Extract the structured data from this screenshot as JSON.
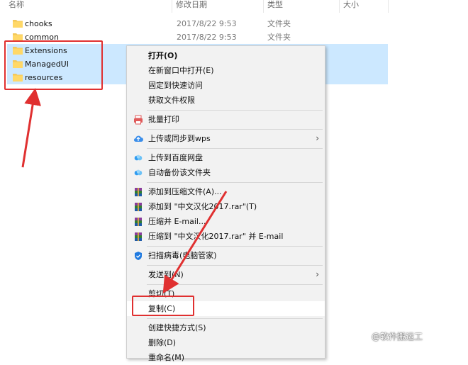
{
  "columns": {
    "name": "名称",
    "date": "修改日期",
    "type": "类型",
    "size": "大小"
  },
  "files": [
    {
      "name": "chooks",
      "date": "2017/8/22 9:53",
      "type": "文件夹",
      "selected": false
    },
    {
      "name": "common",
      "date": "2017/8/22 9:53",
      "type": "文件夹",
      "selected": false
    },
    {
      "name": "Extensions",
      "date": "",
      "type": "",
      "selected": true
    },
    {
      "name": "ManagedUI",
      "date": "",
      "type": "",
      "selected": true
    },
    {
      "name": "resources",
      "date": "",
      "type": "",
      "selected": true
    }
  ],
  "menu": {
    "open": "打开(O)",
    "open_new_window": "在新窗口中打开(E)",
    "pin_quick_access": "固定到快速访问",
    "get_permission": "获取文件权限",
    "batch_print": "批量打印",
    "upload_wps": "上传或同步到wps",
    "upload_baidu": "上传到百度网盘",
    "auto_backup": "自动备份该文件夹",
    "add_archive": "添加到压缩文件(A)...",
    "add_to_rar": "添加到 \"中文汉化2017.rar\"(T)",
    "compress_email": "压缩并 E-mail...",
    "compress_rar_email": "压缩到 \"中文汉化2017.rar\" 并 E-mail",
    "scan_virus": "扫描病毒(电脑管家)",
    "send_to": "发送到(N)",
    "cut": "剪切(T)",
    "copy": "复制(C)",
    "create_shortcut": "创建快捷方式(S)",
    "delete": "删除(D)",
    "rename": "重命名(M)"
  },
  "watermark": "@软件搬运工",
  "colors": {
    "accent_red": "#e03030",
    "selection": "#cce8ff",
    "menu_bg": "#f2f2f2"
  }
}
